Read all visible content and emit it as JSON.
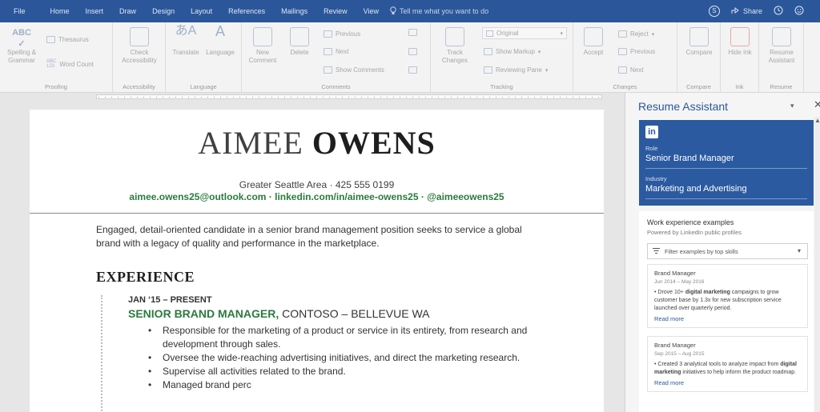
{
  "ribbon_tabs": [
    "File",
    "Home",
    "Insert",
    "Draw",
    "Design",
    "Layout",
    "References",
    "Mailings",
    "Review",
    "View"
  ],
  "tell_me": "Tell me what you want to do",
  "share": "Share",
  "groups": {
    "proofing": {
      "label": "Proofing",
      "spelling": "Spelling & Grammar",
      "thesaurus": "Thesaurus",
      "word_count": "Word Count"
    },
    "accessibility": {
      "label": "Accessibility",
      "check": "Check Accessibility"
    },
    "language": {
      "label": "Language",
      "translate": "Translate",
      "language": "Language"
    },
    "comments": {
      "label": "Comments",
      "new": "New Comment",
      "delete": "Delete",
      "previous": "Previous",
      "next": "Next",
      "show": "Show Comments"
    },
    "tracking": {
      "label": "Tracking",
      "track": "Track Changes",
      "original": "Original",
      "show_markup": "Show Markup",
      "reviewing_pane": "Reviewing Pane"
    },
    "changes": {
      "label": "Changes",
      "accept": "Accept",
      "reject": "Reject",
      "previous": "Previous",
      "next": "Next"
    },
    "compare": {
      "label": "Compare",
      "compare": "Compare"
    },
    "ink": {
      "label": "Ink",
      "hide": "Hide Ink"
    },
    "resume": {
      "label": "Resume",
      "assistant": "Resume Assistant"
    }
  },
  "resume": {
    "first_name": "AIMEE",
    "last_name": "OWENS",
    "location": "Greater Seattle Area",
    "phone": "425 555 0199",
    "contact": "aimee.owens25@outlook.com · linkedin.com/in/aimee-owens25 · @aimeeowens25",
    "summary": "Engaged, detail-oriented candidate in a senior brand management position seeks to service a global brand with a legacy of quality and performance in the marketplace.",
    "experience_heading": "EXPERIENCE",
    "job_dates": "JAN ‘15 – PRESENT",
    "job_role": "SENIOR BRAND MANAGER,",
    "job_company": " CONTOSO – BELLEVUE WA",
    "bullets": [
      "Responsible for the marketing of a product or service in its entirety, from research and development through sales.",
      "Oversee the wide-reaching advertising initiatives, and direct the marketing research.",
      "Supervise all activities related to the brand.",
      "Managed brand perc"
    ]
  },
  "assistant": {
    "title": "Resume Assistant",
    "role_label": "Role",
    "role_value": "Senior Brand Manager",
    "industry_label": "Industry",
    "industry_value": "Marketing and Advertising",
    "examples_title": "Work experience examples",
    "examples_sub": "Powered by LinkedIn public profiles",
    "filter_placeholder": "Filter examples by top skills",
    "cards": [
      {
        "role": "Brand Manager",
        "dates": "Jun 2014 – May 2016",
        "pre": "• Drove 10+ ",
        "bold": "digital marketing",
        "post": " campaigns to grow customer base by 1.3x for new subscription service launched over quarterly period.",
        "more": "Read more"
      },
      {
        "role": "Brand Manager",
        "dates": "Sep 2015 – Aug 2015",
        "pre": "• Created 3 analytical tools to analyze impact from ",
        "bold": "digital marketing",
        "post": " initiatives to help inform the product roadmap.",
        "more": "Read more"
      }
    ]
  },
  "colors": {
    "word_blue": "#2b579a",
    "linkedin_blue": "#2b5aa0",
    "resume_green": "#2c7a3f"
  }
}
